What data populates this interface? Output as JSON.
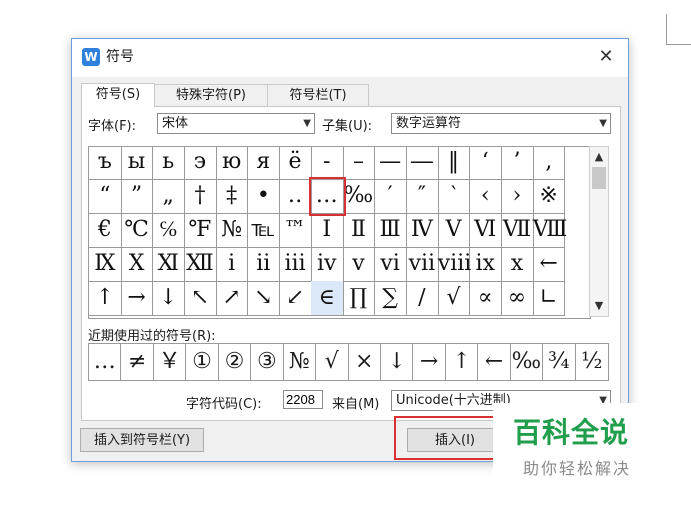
{
  "dialog": {
    "title": "符号",
    "app_icon_letter": "W",
    "close_label": "✕"
  },
  "tabs": [
    {
      "label": "符号(S)",
      "active": true
    },
    {
      "label": "特殊字符(P)",
      "active": false
    },
    {
      "label": "符号栏(T)",
      "active": false
    }
  ],
  "font": {
    "label": "字体(F):",
    "value": "宋体"
  },
  "subset": {
    "label": "子集(U):",
    "value": "数字运算符"
  },
  "symbol_grid": {
    "rows": [
      [
        "ъ",
        "ы",
        "ь",
        "э",
        "ю",
        "я",
        "ё",
        "-",
        "–",
        "—",
        "―",
        "‖",
        "‘",
        "’",
        "‚"
      ],
      [
        "“",
        "”",
        "„",
        "†",
        "‡",
        "•",
        "‥",
        "…",
        "‰",
        "′",
        "″",
        "‵",
        "‹",
        "›",
        "※"
      ],
      [
        "€",
        "℃",
        "℅",
        "℉",
        "№",
        "℡",
        "™",
        "Ⅰ",
        "Ⅱ",
        "Ⅲ",
        "Ⅳ",
        "Ⅴ",
        "Ⅵ",
        "Ⅶ",
        "Ⅷ"
      ],
      [
        "Ⅸ",
        "Ⅹ",
        "Ⅺ",
        "Ⅻ",
        "ⅰ",
        "ⅱ",
        "ⅲ",
        "ⅳ",
        "ⅴ",
        "ⅵ",
        "ⅶ",
        "ⅷ",
        "ⅸ",
        "ⅹ",
        "←"
      ],
      [
        "↑",
        "→",
        "↓",
        "↖",
        "↗",
        "↘",
        "↙",
        "∈",
        "∏",
        "∑",
        "∕",
        "√",
        "∝",
        "∞",
        "∟"
      ]
    ],
    "selected": [
      4,
      7
    ],
    "highlighted": [
      1,
      7
    ]
  },
  "recent": {
    "label": "近期使用过的符号(R):",
    "symbols": [
      "…",
      "≠",
      "￥",
      "①",
      "②",
      "③",
      "№",
      "√",
      "×",
      "↓",
      "→",
      "↑",
      "←",
      "‰",
      "¾",
      "½"
    ]
  },
  "char_code": {
    "label": "字符代码(C):",
    "value": "2208"
  },
  "from": {
    "label": "来自(M)",
    "value": "Unicode(十六进制)"
  },
  "buttons": {
    "insert_to_bar": "插入到符号栏(Y)",
    "insert": "插入(I)"
  },
  "watermark": {
    "main": "百科全说",
    "sub": "助你轻松解决"
  },
  "icons": {
    "close": "close-icon",
    "dropdown": "chevron-down-icon",
    "scroll_up": "chevron-up-icon",
    "scroll_down": "chevron-down-icon"
  },
  "colors": {
    "accent": "#2f7fdc",
    "highlight": "#d9312f",
    "watermark": "#1f9e4b"
  }
}
